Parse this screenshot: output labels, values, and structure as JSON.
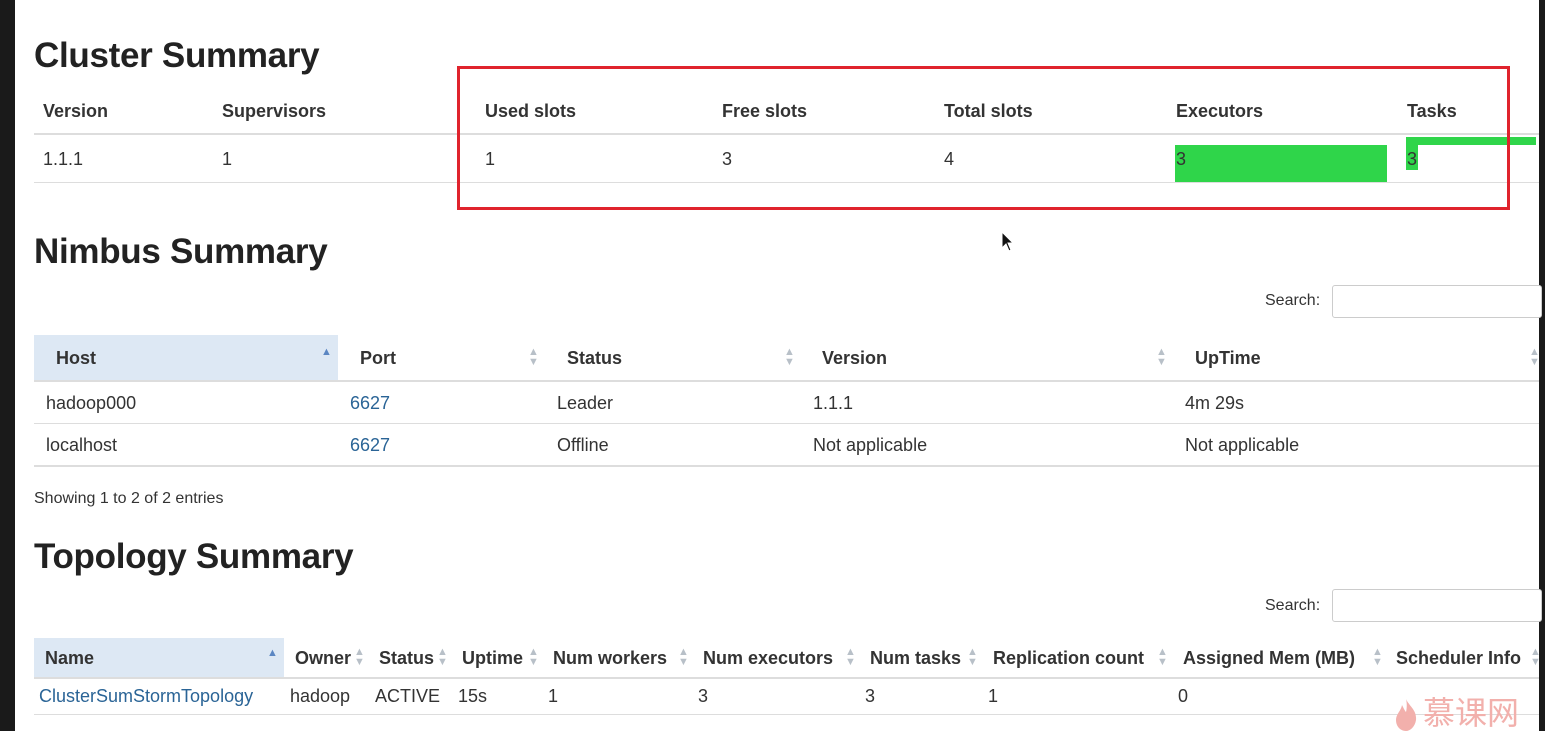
{
  "cluster": {
    "title": "Cluster Summary",
    "headers": [
      "Version",
      "Supervisors",
      "Used slots",
      "Free slots",
      "Total slots",
      "Executors",
      "Tasks"
    ],
    "row": [
      "1.1.1",
      "1",
      "1",
      "3",
      "4",
      "3",
      "3"
    ]
  },
  "nimbus": {
    "title": "Nimbus Summary",
    "search_label": "Search:",
    "search_value": "",
    "headers": [
      "Host",
      "Port",
      "Status",
      "Version",
      "UpTime"
    ],
    "rows": [
      [
        "hadoop000",
        "6627",
        "Leader",
        "1.1.1",
        "4m 29s"
      ],
      [
        "localhost",
        "6627",
        "Offline",
        "Not applicable",
        "Not applicable"
      ]
    ],
    "info": "Showing 1 to 2 of 2 entries"
  },
  "topology": {
    "title": "Topology Summary",
    "search_label": "Search:",
    "search_value": "",
    "headers": [
      "Name",
      "Owner",
      "Status",
      "Uptime",
      "Num workers",
      "Num executors",
      "Num tasks",
      "Replication count",
      "Assigned Mem (MB)",
      "Scheduler Info"
    ],
    "rows": [
      [
        "ClusterSumStormTopology",
        "hadoop",
        "ACTIVE",
        "15s",
        "1",
        "3",
        "3",
        "1",
        "0",
        ""
      ]
    ]
  },
  "watermark": {
    "text": "慕课网"
  },
  "colors": {
    "link": "#2a6496",
    "highlight": "#e0232d",
    "green_mark": "#2fd54a",
    "sort_active_bg": "#dde8f4"
  }
}
